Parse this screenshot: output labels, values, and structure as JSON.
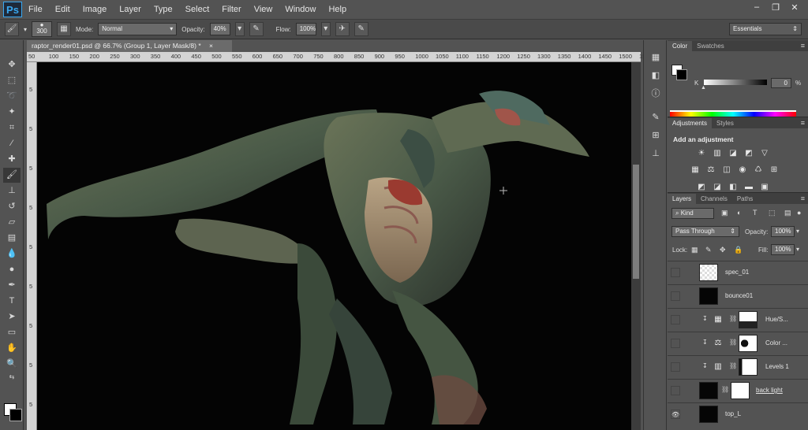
{
  "app": {
    "logo": "Ps"
  },
  "menu": [
    "File",
    "Edit",
    "Image",
    "Layer",
    "Type",
    "Select",
    "Filter",
    "View",
    "Window",
    "Help"
  ],
  "window_controls": {
    "minimize": "–",
    "restore": "❐",
    "close": "✕"
  },
  "options": {
    "brush_size": "300",
    "mode_label": "Mode:",
    "mode_value": "Normal",
    "opacity_label": "Opacity:",
    "opacity_value": "40%",
    "flow_label": "Flow:",
    "flow_value": "100%",
    "workspace": "Essentials"
  },
  "document": {
    "tab_title": "raptor_render01.psd @ 66.7% (Group 1, Layer Mask/8) *",
    "close": "×"
  },
  "ruler_h_ticks": [
    "50",
    "100",
    "150",
    "200",
    "250",
    "300",
    "350",
    "400",
    "450",
    "500",
    "550",
    "600",
    "650",
    "700",
    "750",
    "800",
    "850",
    "900",
    "950",
    "1000",
    "1050",
    "1100",
    "1150",
    "1200",
    "1250",
    "1300",
    "1350",
    "1400",
    "1450",
    "1500",
    "155"
  ],
  "color_panel": {
    "tabs": [
      "Color",
      "Swatches"
    ],
    "channel": "K",
    "value": "0",
    "unit": "%"
  },
  "adjustments_panel": {
    "tabs": [
      "Adjustments",
      "Styles"
    ],
    "heading": "Add an adjustment"
  },
  "layers_panel": {
    "tabs": [
      "Layers",
      "Channels",
      "Paths"
    ],
    "filter_kind": "Kind",
    "blend_mode": "Pass Through",
    "opacity_label": "Opacity:",
    "opacity_value": "100%",
    "lock_label": "Lock:",
    "fill_label": "Fill:",
    "fill_value": "100%",
    "layers": [
      {
        "name": "spec_01"
      },
      {
        "name": "bounce01"
      },
      {
        "name": "Hue/S..."
      },
      {
        "name": "Color ..."
      },
      {
        "name": "Levels 1"
      },
      {
        "name": "back light"
      },
      {
        "name": "top_L"
      }
    ]
  },
  "colors": {
    "accent": "#3aa8f0",
    "canvas": "#040404",
    "ui": "#535353"
  }
}
